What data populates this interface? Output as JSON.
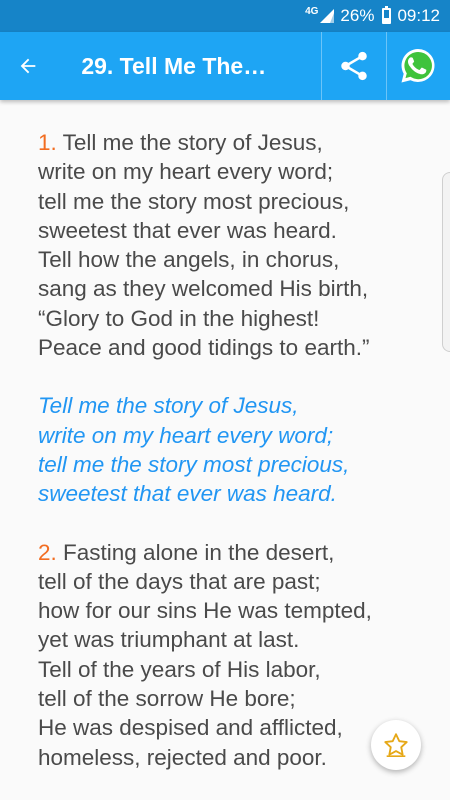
{
  "status_bar": {
    "network": "4G",
    "battery": "26%",
    "time": "09:12"
  },
  "app_bar": {
    "title": "29. Tell Me The…",
    "back_icon": "arrow-back-icon",
    "share_icon": "share-icon",
    "whatsapp_icon": "whatsapp-icon"
  },
  "colors": {
    "status_bar": "#1684c8",
    "app_bar": "#1ea5f4",
    "verse_number": "#f26d21",
    "chorus": "#2196f3",
    "text": "#4a4a4a"
  },
  "hymn": {
    "stanza1": {
      "number": "1.",
      "lines": [
        " Tell me the story of Jesus,",
        "write on my heart every word;",
        "tell me the story most precious,",
        "sweetest that ever was heard.",
        "Tell how the angels, in chorus,",
        "sang as they welcomed His birth,",
        "“Glory to God in the highest!",
        "Peace and good tidings to earth.”"
      ]
    },
    "chorus": {
      "lines": [
        "Tell me the story of Jesus,",
        "write on my heart every word;",
        "tell me the story most precious,",
        "sweetest that ever was heard."
      ]
    },
    "stanza2": {
      "number": "2.",
      "lines": [
        " Fasting alone in the desert,",
        "tell of the days that are past;",
        "how for our sins He was tempted,",
        "yet was triumphant at last.",
        "Tell of the years of His labor,",
        "tell of the sorrow He bore;",
        "He was despised and afflicted,",
        "homeless, rejected and poor."
      ]
    }
  },
  "fab": {
    "icon": "star-outline-icon"
  }
}
